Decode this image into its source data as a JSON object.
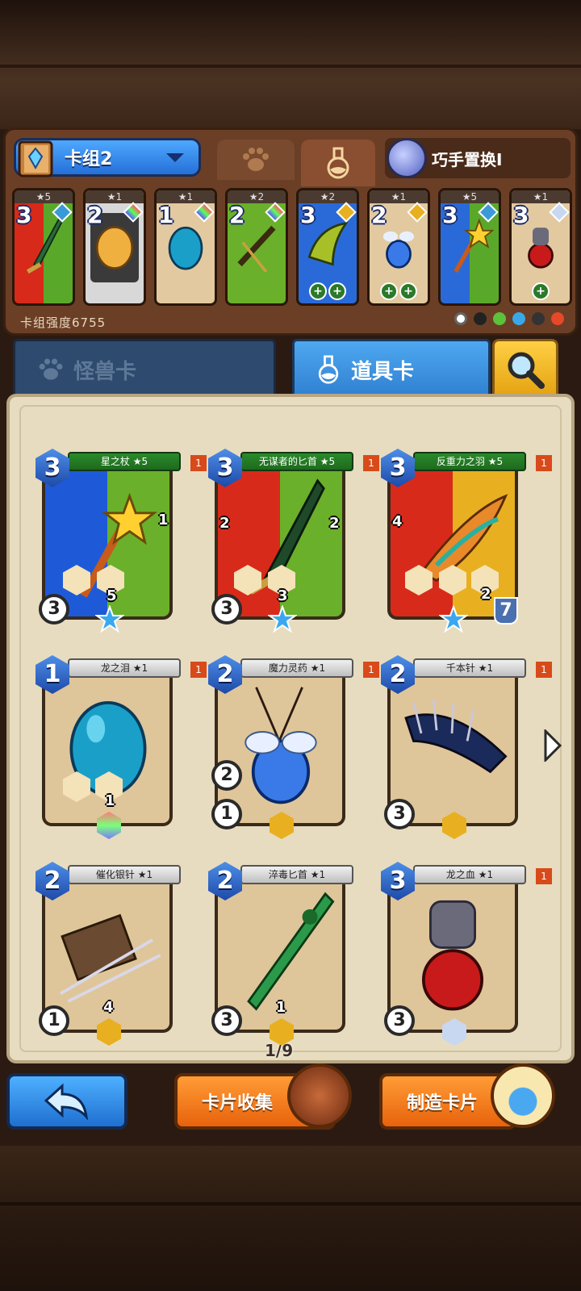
{
  "deck": {
    "name": "卡组2",
    "skill_name": "巧手置换I",
    "power_label": "卡组强度6755",
    "cards": [
      {
        "stars": "★5",
        "cost": "3",
        "badges": []
      },
      {
        "stars": "★1",
        "cost": "2",
        "badges": []
      },
      {
        "stars": "★1",
        "cost": "1",
        "badges": []
      },
      {
        "stars": "★2",
        "cost": "2",
        "badges": []
      },
      {
        "stars": "★2",
        "cost": "3",
        "badges": [
          "+",
          "+"
        ]
      },
      {
        "stars": "★1",
        "cost": "2",
        "badges": [
          "+",
          "+"
        ]
      },
      {
        "stars": "★5",
        "cost": "3",
        "badges": []
      },
      {
        "stars": "★1",
        "cost": "3",
        "badges": [
          "+"
        ]
      }
    ],
    "element_colors": [
      "#ffffff",
      "#222222",
      "#5bc23a",
      "#3aa8e8",
      "#333333",
      "#e8482a"
    ]
  },
  "tabs": {
    "monster": "怪兽卡",
    "item": "道具卡"
  },
  "cards": [
    {
      "name": "星之杖 ★5",
      "cost": "3",
      "flag": "1",
      "stat_left": "3",
      "hex1": "",
      "hex2": "5",
      "side": "1"
    },
    {
      "name": "无谋者的匕首 ★5",
      "cost": "3",
      "flag": "1",
      "stat_left": "3",
      "hex1": "",
      "hex2": "3",
      "side_left": "2",
      "side": "2"
    },
    {
      "name": "反重力之羽 ★5",
      "cost": "3",
      "flag": "1",
      "level": "7",
      "side_left": "4",
      "hex3": "2"
    },
    {
      "name": "龙之泪 ★1",
      "cost": "1",
      "flag": "1",
      "hex2": "1"
    },
    {
      "name": "魔力灵药 ★1",
      "cost": "2",
      "flag": "1",
      "stat_a": "2",
      "stat_b": "1"
    },
    {
      "name": "千本针 ★1",
      "cost": "2",
      "flag": "1",
      "stat_left": "3"
    },
    {
      "name": "催化银针 ★1",
      "cost": "2",
      "stat_left": "1",
      "hex2": "4"
    },
    {
      "name": "淬毒匕首 ★1",
      "cost": "2",
      "stat_left": "3",
      "hex2": "1"
    },
    {
      "name": "龙之血 ★1",
      "cost": "3",
      "flag": "1",
      "stat_left": "3"
    }
  ],
  "page_indicator": "1/9",
  "buttons": {
    "collect": "卡片收集",
    "craft": "制造卡片"
  }
}
